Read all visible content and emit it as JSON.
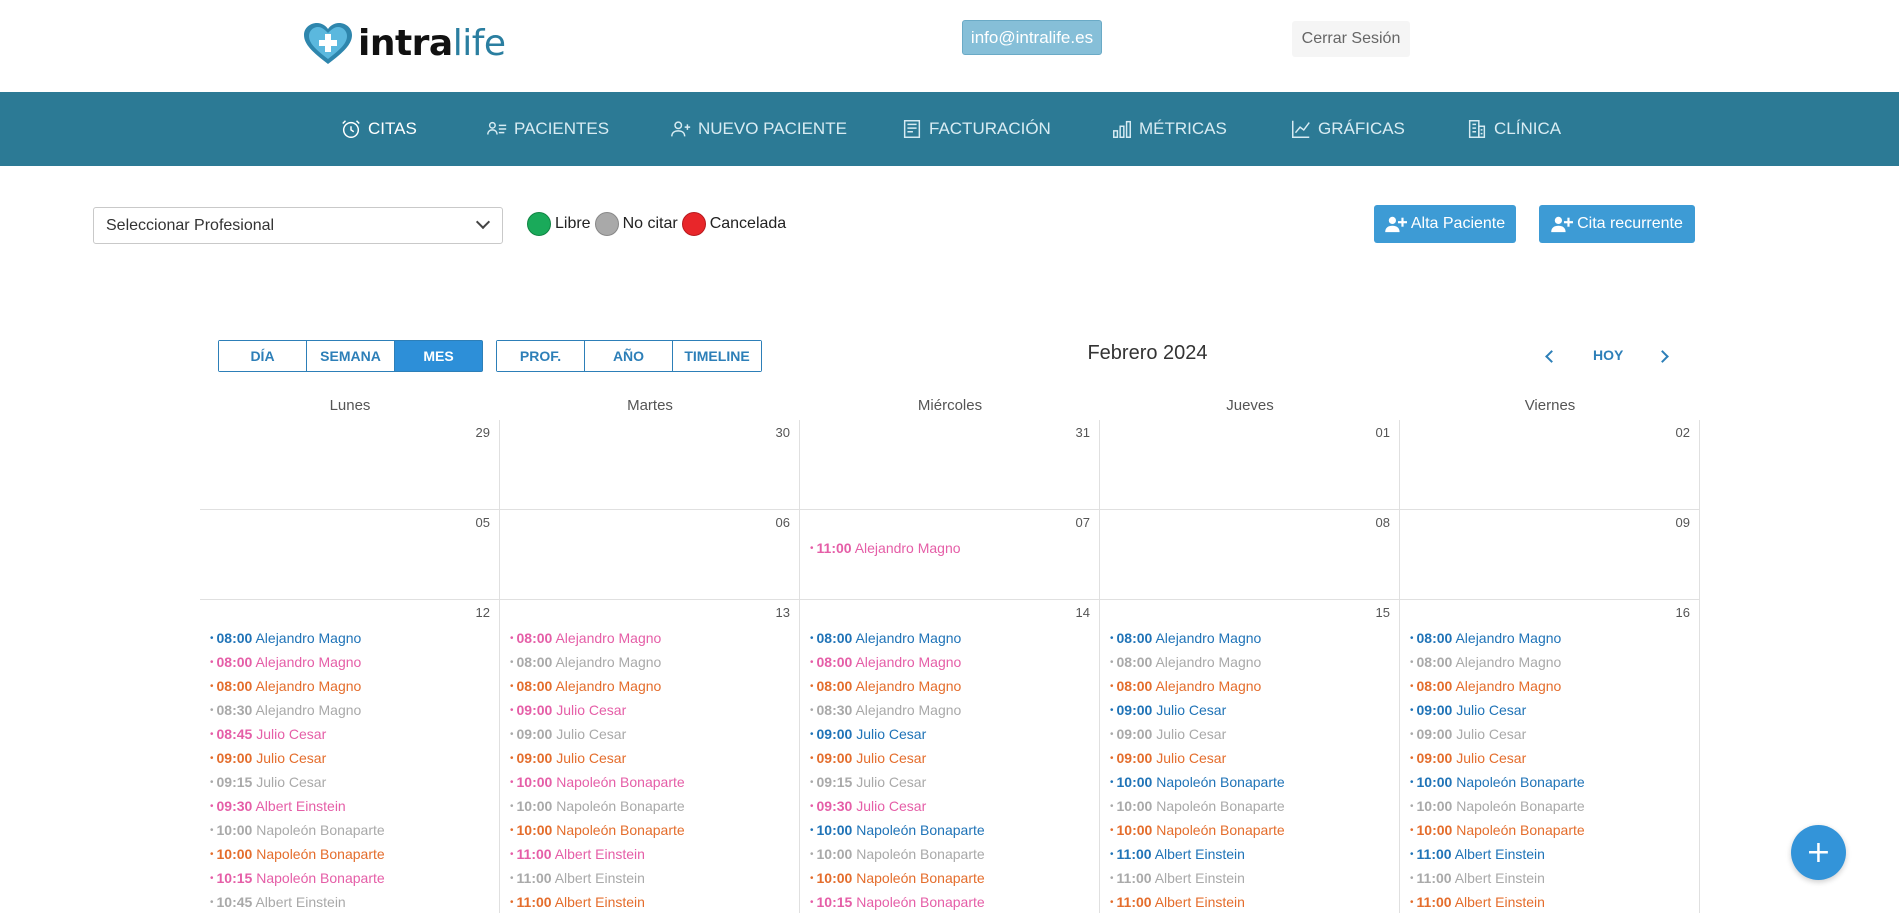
{
  "header": {
    "logo_bold": "intra",
    "logo_light": "life",
    "email": "info@intralife.es",
    "logout": "Cerrar Sesión"
  },
  "nav": [
    {
      "label": "CITAS",
      "icon": "alarm-clock-icon",
      "active": true
    },
    {
      "label": "PACIENTES",
      "icon": "users-list-icon",
      "active": false
    },
    {
      "label": "NUEVO PACIENTE",
      "icon": "user-plus-icon",
      "active": false
    },
    {
      "label": "FACTURACIÓN",
      "icon": "invoice-icon",
      "active": false
    },
    {
      "label": "MÉTRICAS",
      "icon": "bar-chart-icon",
      "active": false
    },
    {
      "label": "GRÁFICAS",
      "icon": "line-chart-icon",
      "active": false
    },
    {
      "label": "CLÍNICA",
      "icon": "building-icon",
      "active": false
    }
  ],
  "toolbar": {
    "professional_select": "Seleccionar Profesional",
    "legend": [
      {
        "label": "Libre",
        "color": "#1aaa5a"
      },
      {
        "label": "No citar",
        "color": "#a9a9a9"
      },
      {
        "label": "Cancelada",
        "color": "#e8262a"
      }
    ],
    "alta_paciente": "Alta Paciente",
    "cita_recurrente": "Cita recurrente"
  },
  "calendar": {
    "views_left": [
      {
        "label": "DÍA",
        "active": false
      },
      {
        "label": "SEMANA",
        "active": false
      },
      {
        "label": "MES",
        "active": true
      }
    ],
    "views_right": [
      {
        "label": "PROF.",
        "active": false
      },
      {
        "label": "AÑO",
        "active": false
      },
      {
        "label": "TIMELINE",
        "active": false
      }
    ],
    "title": "Febrero 2024",
    "today": "HOY",
    "weekdays": [
      "Lunes",
      "Martes",
      "Miércoles",
      "Jueves",
      "Viernes"
    ],
    "weeks": [
      {
        "days": [
          {
            "num": "29",
            "events": []
          },
          {
            "num": "30",
            "events": []
          },
          {
            "num": "31",
            "events": []
          },
          {
            "num": "01",
            "events": []
          },
          {
            "num": "02",
            "events": []
          }
        ]
      },
      {
        "days": [
          {
            "num": "05",
            "events": []
          },
          {
            "num": "06",
            "events": []
          },
          {
            "num": "07",
            "events": [
              {
                "time": "11:00",
                "name": "Alejandro Magno",
                "color": "pink"
              }
            ]
          },
          {
            "num": "08",
            "events": []
          },
          {
            "num": "09",
            "events": []
          }
        ]
      },
      {
        "days": [
          {
            "num": "12",
            "events": [
              {
                "time": "08:00",
                "name": "Alejandro Magno",
                "color": "blue"
              },
              {
                "time": "08:00",
                "name": "Alejandro Magno",
                "color": "pink"
              },
              {
                "time": "08:00",
                "name": "Alejandro Magno",
                "color": "orange"
              },
              {
                "time": "08:30",
                "name": "Alejandro Magno",
                "color": "gray"
              },
              {
                "time": "08:45",
                "name": "Julio Cesar",
                "color": "pink"
              },
              {
                "time": "09:00",
                "name": "Julio Cesar",
                "color": "orange"
              },
              {
                "time": "09:15",
                "name": "Julio Cesar",
                "color": "gray"
              },
              {
                "time": "09:30",
                "name": "Albert Einstein",
                "color": "pink"
              },
              {
                "time": "10:00",
                "name": "Napoleón Bonaparte",
                "color": "gray"
              },
              {
                "time": "10:00",
                "name": "Napoleón Bonaparte",
                "color": "orange"
              },
              {
                "time": "10:15",
                "name": "Napoleón Bonaparte",
                "color": "pink"
              },
              {
                "time": "10:45",
                "name": "Albert Einstein",
                "color": "gray"
              }
            ]
          },
          {
            "num": "13",
            "events": [
              {
                "time": "08:00",
                "name": "Alejandro Magno",
                "color": "pink"
              },
              {
                "time": "08:00",
                "name": "Alejandro Magno",
                "color": "gray"
              },
              {
                "time": "08:00",
                "name": "Alejandro Magno",
                "color": "orange"
              },
              {
                "time": "09:00",
                "name": "Julio Cesar",
                "color": "pink"
              },
              {
                "time": "09:00",
                "name": "Julio Cesar",
                "color": "gray"
              },
              {
                "time": "09:00",
                "name": "Julio Cesar",
                "color": "orange"
              },
              {
                "time": "10:00",
                "name": "Napoleón Bonaparte",
                "color": "pink"
              },
              {
                "time": "10:00",
                "name": "Napoleón Bonaparte",
                "color": "gray"
              },
              {
                "time": "10:00",
                "name": "Napoleón Bonaparte",
                "color": "orange"
              },
              {
                "time": "11:00",
                "name": "Albert Einstein",
                "color": "pink"
              },
              {
                "time": "11:00",
                "name": "Albert Einstein",
                "color": "gray"
              },
              {
                "time": "11:00",
                "name": "Albert Einstein",
                "color": "orange"
              }
            ]
          },
          {
            "num": "14",
            "events": [
              {
                "time": "08:00",
                "name": "Alejandro Magno",
                "color": "blue"
              },
              {
                "time": "08:00",
                "name": "Alejandro Magno",
                "color": "pink"
              },
              {
                "time": "08:00",
                "name": "Alejandro Magno",
                "color": "orange"
              },
              {
                "time": "08:30",
                "name": "Alejandro Magno",
                "color": "gray"
              },
              {
                "time": "09:00",
                "name": "Julio Cesar",
                "color": "blue"
              },
              {
                "time": "09:00",
                "name": "Julio Cesar",
                "color": "orange"
              },
              {
                "time": "09:15",
                "name": "Julio Cesar",
                "color": "gray"
              },
              {
                "time": "09:30",
                "name": "Julio Cesar",
                "color": "pink"
              },
              {
                "time": "10:00",
                "name": "Napoleón Bonaparte",
                "color": "blue"
              },
              {
                "time": "10:00",
                "name": "Napoleón Bonaparte",
                "color": "gray"
              },
              {
                "time": "10:00",
                "name": "Napoleón Bonaparte",
                "color": "orange"
              },
              {
                "time": "10:15",
                "name": "Napoleón Bonaparte",
                "color": "pink"
              }
            ]
          },
          {
            "num": "15",
            "events": [
              {
                "time": "08:00",
                "name": "Alejandro Magno",
                "color": "blue"
              },
              {
                "time": "08:00",
                "name": "Alejandro Magno",
                "color": "gray"
              },
              {
                "time": "08:00",
                "name": "Alejandro Magno",
                "color": "orange"
              },
              {
                "time": "09:00",
                "name": "Julio Cesar",
                "color": "blue"
              },
              {
                "time": "09:00",
                "name": "Julio Cesar",
                "color": "gray"
              },
              {
                "time": "09:00",
                "name": "Julio Cesar",
                "color": "orange"
              },
              {
                "time": "10:00",
                "name": "Napoleón Bonaparte",
                "color": "blue"
              },
              {
                "time": "10:00",
                "name": "Napoleón Bonaparte",
                "color": "gray"
              },
              {
                "time": "10:00",
                "name": "Napoleón Bonaparte",
                "color": "orange"
              },
              {
                "time": "11:00",
                "name": "Albert Einstein",
                "color": "blue"
              },
              {
                "time": "11:00",
                "name": "Albert Einstein",
                "color": "gray"
              },
              {
                "time": "11:00",
                "name": "Albert Einstein",
                "color": "orange"
              }
            ]
          },
          {
            "num": "16",
            "events": [
              {
                "time": "08:00",
                "name": "Alejandro Magno",
                "color": "blue"
              },
              {
                "time": "08:00",
                "name": "Alejandro Magno",
                "color": "gray"
              },
              {
                "time": "08:00",
                "name": "Alejandro Magno",
                "color": "orange"
              },
              {
                "time": "09:00",
                "name": "Julio Cesar",
                "color": "blue"
              },
              {
                "time": "09:00",
                "name": "Julio Cesar",
                "color": "gray"
              },
              {
                "time": "09:00",
                "name": "Julio Cesar",
                "color": "orange"
              },
              {
                "time": "10:00",
                "name": "Napoleón Bonaparte",
                "color": "blue"
              },
              {
                "time": "10:00",
                "name": "Napoleón Bonaparte",
                "color": "gray"
              },
              {
                "time": "10:00",
                "name": "Napoleón Bonaparte",
                "color": "orange"
              },
              {
                "time": "11:00",
                "name": "Albert Einstein",
                "color": "blue"
              },
              {
                "time": "11:00",
                "name": "Albert Einstein",
                "color": "gray"
              },
              {
                "time": "11:00",
                "name": "Albert Einstein",
                "color": "orange"
              }
            ]
          }
        ]
      }
    ]
  },
  "fab": {
    "label": "+",
    "icon": "plus-icon"
  }
}
